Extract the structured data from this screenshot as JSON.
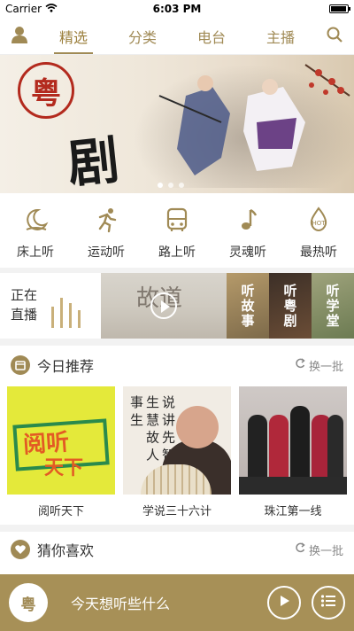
{
  "status_bar": {
    "carrier": "Carrier",
    "time": "6:03 PM"
  },
  "top_nav": {
    "tabs": [
      {
        "label": "精选",
        "active": true
      },
      {
        "label": "分类",
        "active": false
      },
      {
        "label": "电台",
        "active": false
      },
      {
        "label": "主播",
        "active": false
      }
    ],
    "icons": [
      "user-icon",
      "search-icon"
    ]
  },
  "banner": {
    "seal_text": "粤",
    "calligraphy_text": "剧",
    "page_count": 3,
    "active_page": 1
  },
  "categories": [
    {
      "label": "床上听",
      "icon": "moon-icon"
    },
    {
      "label": "运动听",
      "icon": "runner-icon"
    },
    {
      "label": "路上听",
      "icon": "bus-icon"
    },
    {
      "label": "灵魂听",
      "icon": "music-note-icon"
    },
    {
      "label": "最热听",
      "icon": "hot-icon"
    }
  ],
  "live": {
    "line1": "正在",
    "line2": "直播"
  },
  "tiles": [
    {
      "label": "听故事"
    },
    {
      "label": "听粤剧"
    },
    {
      "label": "听学堂"
    }
  ],
  "recommend": {
    "title": "今日推荐",
    "refresh": "换一批",
    "cards": [
      {
        "caption": "阅听天下",
        "art_line1": "阅听",
        "art_line2": "天下"
      },
      {
        "caption": "学说三十六计",
        "art_text": "说 讲 先 智 生 慧 故 人 事 生"
      },
      {
        "caption": "珠江第一线"
      }
    ]
  },
  "guess": {
    "title": "猜你喜欢",
    "refresh": "换一批"
  },
  "player": {
    "logo": "粤",
    "hint": "今天想听些什么"
  },
  "colors": {
    "accent": "#a79057",
    "tab_text": "#a08a55"
  }
}
